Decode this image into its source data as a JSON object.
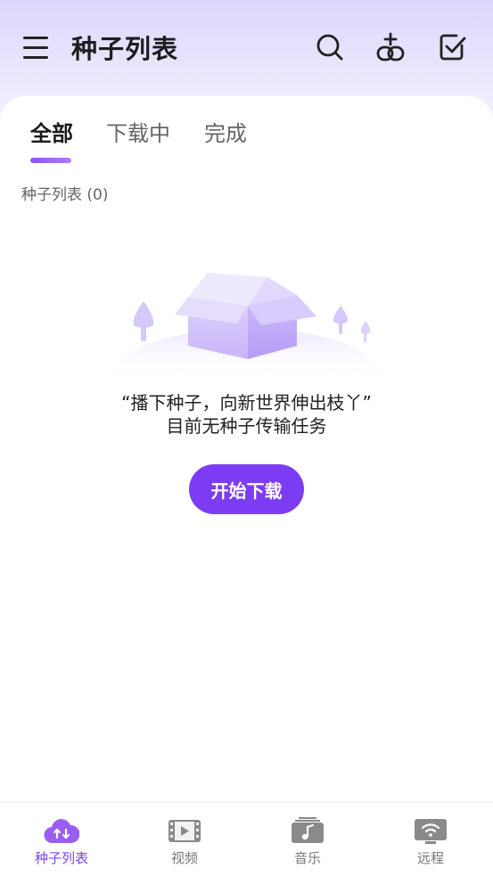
{
  "header": {
    "title": "种子列表",
    "icons": [
      "menu-icon",
      "search-icon",
      "add-link-icon",
      "select-checkbox-icon"
    ]
  },
  "tabs": [
    {
      "label": "全部",
      "active": true
    },
    {
      "label": "下载中",
      "active": false
    },
    {
      "label": "完成",
      "active": false
    }
  ],
  "list": {
    "count_label": "种子列表 (0)"
  },
  "empty_state": {
    "quote": "“播下种子，向新世界伸出枝丫”",
    "message": "目前无种子传输任务",
    "button_label": "开始下载"
  },
  "bottom_nav": [
    {
      "label": "种子列表",
      "icon": "cloud-transfer-icon",
      "active": true
    },
    {
      "label": "视频",
      "icon": "film-icon",
      "active": false
    },
    {
      "label": "音乐",
      "icon": "music-icon",
      "active": false
    },
    {
      "label": "远程",
      "icon": "remote-wifi-icon",
      "active": false
    }
  ],
  "colors": {
    "accent": "#7b3cf3",
    "header_gradient": "#dcd6fb",
    "inactive_nav": "#8a8a8a"
  }
}
